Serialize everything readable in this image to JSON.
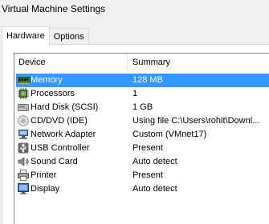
{
  "window": {
    "title": "Virtual Machine Settings"
  },
  "tabs": [
    {
      "label": "Hardware",
      "active": true
    },
    {
      "label": "Options",
      "active": false
    }
  ],
  "list": {
    "headers": {
      "device": "Device",
      "summary": "Summary"
    },
    "rows": [
      {
        "device": "Memory",
        "summary": "128 MB",
        "icon": "memory-icon",
        "selected": true
      },
      {
        "device": "Processors",
        "summary": "1",
        "icon": "processor-icon",
        "selected": false
      },
      {
        "device": "Hard Disk (SCSI)",
        "summary": "1 GB",
        "icon": "hard-disk-icon",
        "selected": false
      },
      {
        "device": "CD/DVD (IDE)",
        "summary": "Using file C:\\Users\\rohit\\Downl...",
        "icon": "cd-dvd-icon",
        "selected": false
      },
      {
        "device": "Network Adapter",
        "summary": "Custom (VMnet17)",
        "icon": "network-adapter-icon",
        "selected": false
      },
      {
        "device": "USB Controller",
        "summary": "Present",
        "icon": "usb-icon",
        "selected": false
      },
      {
        "device": "Sound Card",
        "summary": "Auto detect",
        "icon": "speaker-icon",
        "selected": false
      },
      {
        "device": "Printer",
        "summary": "Present",
        "icon": "printer-icon",
        "selected": false
      },
      {
        "device": "Display",
        "summary": "Auto detect",
        "icon": "monitor-icon",
        "selected": false
      }
    ]
  },
  "colors": {
    "selection": "#3399ff",
    "border": "#828790"
  }
}
